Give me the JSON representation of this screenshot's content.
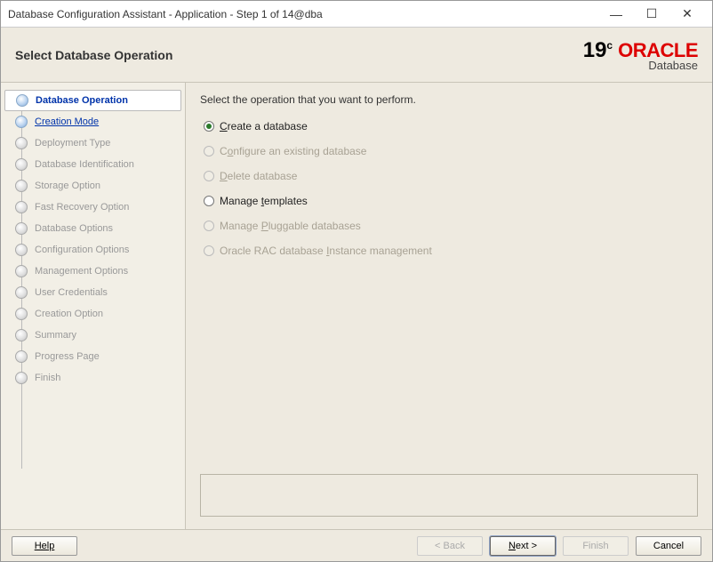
{
  "window": {
    "title": "Database Configuration Assistant - Application - Step 1 of 14@dba"
  },
  "header": {
    "title": "Select Database Operation",
    "brand_version": "19",
    "brand_version_sup": "c",
    "brand_name": "ORACLE",
    "brand_sub": "Database"
  },
  "sidebar": {
    "items": [
      {
        "label": "Database Operation",
        "state": "current"
      },
      {
        "label": "Creation Mode",
        "state": "next"
      },
      {
        "label": "Deployment Type",
        "state": "future"
      },
      {
        "label": "Database Identification",
        "state": "future"
      },
      {
        "label": "Storage Option",
        "state": "future"
      },
      {
        "label": "Fast Recovery Option",
        "state": "future"
      },
      {
        "label": "Database Options",
        "state": "future"
      },
      {
        "label": "Configuration Options",
        "state": "future"
      },
      {
        "label": "Management Options",
        "state": "future"
      },
      {
        "label": "User Credentials",
        "state": "future"
      },
      {
        "label": "Creation Option",
        "state": "future"
      },
      {
        "label": "Summary",
        "state": "future"
      },
      {
        "label": "Progress Page",
        "state": "future"
      },
      {
        "label": "Finish",
        "state": "future"
      }
    ]
  },
  "content": {
    "instruction": "Select the operation that you want to perform.",
    "options": [
      {
        "pre": "",
        "u": "C",
        "post": "reate a database",
        "selected": true,
        "enabled": true
      },
      {
        "pre": "C",
        "u": "o",
        "post": "nfigure an existing database",
        "selected": false,
        "enabled": false
      },
      {
        "pre": "",
        "u": "D",
        "post": "elete database",
        "selected": false,
        "enabled": false
      },
      {
        "pre": "Manage ",
        "u": "t",
        "post": "emplates",
        "selected": false,
        "enabled": true
      },
      {
        "pre": "Manage ",
        "u": "P",
        "post": "luggable databases",
        "selected": false,
        "enabled": false
      },
      {
        "pre": "Oracle RAC database ",
        "u": "I",
        "post": "nstance management",
        "selected": false,
        "enabled": false
      }
    ]
  },
  "footer": {
    "help": "Help",
    "back": "< Back",
    "next_pre": "",
    "next_u": "N",
    "next_post": "ext >",
    "finish": "Finish",
    "cancel": "Cancel"
  }
}
